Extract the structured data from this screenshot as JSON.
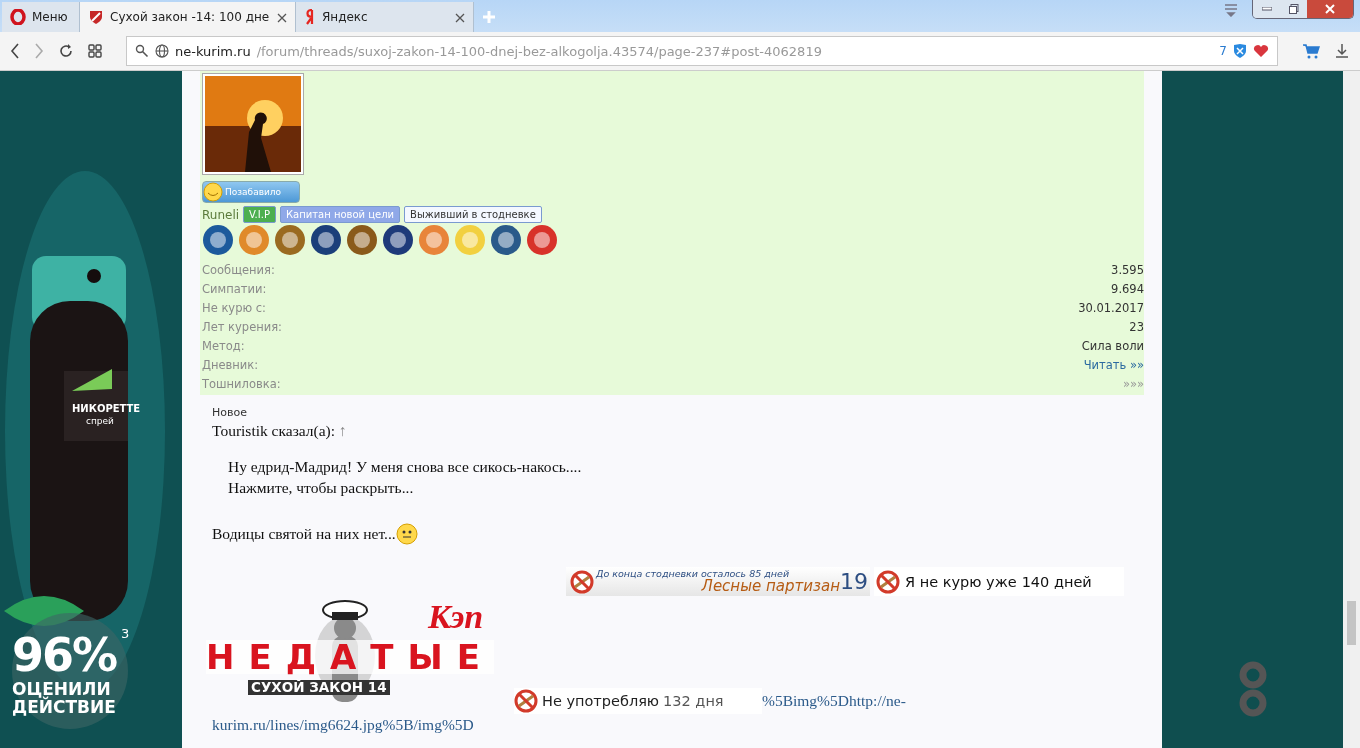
{
  "browser": {
    "tabs": [
      {
        "label": "Меню",
        "kind": "menu",
        "selected": false
      },
      {
        "label": "Сухой закон -14: 100 дне",
        "kind": "page",
        "selected": true
      },
      {
        "label": "Яндекс",
        "kind": "yandex",
        "selected": false
      }
    ],
    "url": {
      "host": "ne-kurim.ru",
      "path": "/forum/threads/suxoj-zakon-14-100-dnej-bez-alkogolja.43574/page-237#post-4062819"
    },
    "blocked_count": "7"
  },
  "ad": {
    "brand": "НИКОРЕТТЕ",
    "product": "спрей",
    "percent": "96%",
    "footnote": "3",
    "caption": [
      "ОЦЕНИЛИ",
      "ДЕЙСТВИЕ"
    ]
  },
  "profile": {
    "reaction": "Позабавило",
    "username": "Runeli",
    "tags": [
      {
        "label": "V.I.P",
        "color": "#4caf50"
      },
      {
        "label": "Капитан новой цели",
        "color": "#8fa8e8"
      },
      {
        "label": "Выживший в стодневке",
        "color": "#f4f8ff"
      }
    ],
    "stats": [
      {
        "label": "Сообщения:",
        "value": "3.595",
        "kind": "text"
      },
      {
        "label": "Симпатии:",
        "value": "9.694",
        "kind": "text"
      },
      {
        "label": "Не курю с:",
        "value": "30.01.2017",
        "kind": "text"
      },
      {
        "label": "Лет курения:",
        "value": "23",
        "kind": "text"
      },
      {
        "label": "Метод:",
        "value": "Сила воли",
        "kind": "text"
      },
      {
        "label": "Дневник:",
        "value": "Читать »»",
        "kind": "link"
      },
      {
        "label": "Тошниловка:",
        "value": "»»»",
        "kind": "muted"
      }
    ]
  },
  "post": {
    "new_label": "Новое",
    "quote_author": "Touristik сказал(а):",
    "quote_link": "↑",
    "quote_text": "Ну едрид-Мадрид! У меня снова все сикось-накось....",
    "expand": "Нажмите, чтобы раскрыть...",
    "body": "Водицы святой на них нет..."
  },
  "signature": {
    "userbars": [
      {
        "kind": "counter",
        "text": "До конца стодневки осталось 85 дней",
        "sub": "Лесные партизан",
        "number": "19"
      },
      {
        "kind": "plain",
        "text": "Я не курю уже",
        "value": "140 дней"
      }
    ],
    "logo": {
      "tag": "Кэп",
      "title": "НЕДАТЫЕ",
      "subtitle": "СУХОЙ ЗАКОН 14"
    },
    "small_bar": {
      "text": "Не употребляю",
      "value": "132 дня"
    },
    "link_lines": [
      "%5Bimg%5Dhttp://ne-",
      "kurim.ru/lines/img6624.jpg%5B/img%5D"
    ]
  }
}
